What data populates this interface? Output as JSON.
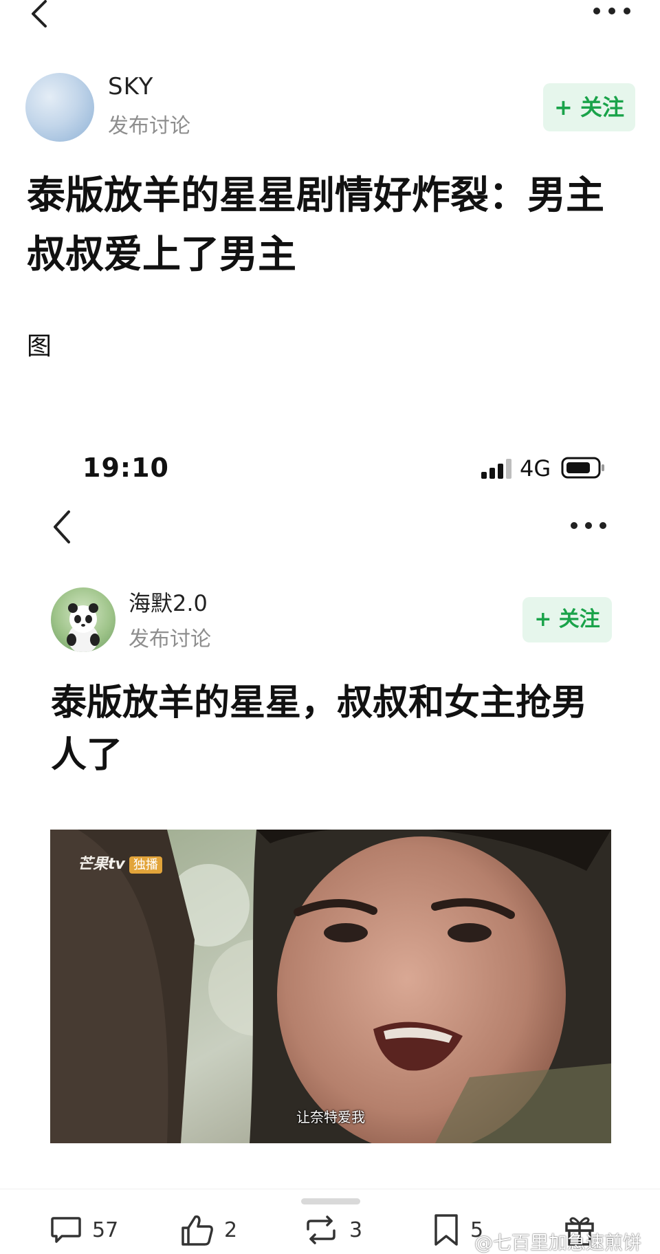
{
  "outer_post": {
    "author": {
      "name": "SKY",
      "subtitle": "发布讨论"
    },
    "follow_label": "+ 关注",
    "title": "泰版放羊的星星剧情好炸裂：男主叔叔爱上了男主",
    "body_text": "图"
  },
  "embedded_screenshot": {
    "status_bar": {
      "time": "19:10",
      "network": "4G"
    },
    "author": {
      "name": "海默2.0",
      "subtitle": "发布讨论"
    },
    "follow_label": "+ 关注",
    "title": "泰版放羊的星星，叔叔和女主抢男人了",
    "video": {
      "logo_text": "芒果tv",
      "logo_badge": "独播",
      "subtitle": "让奈特爱我"
    }
  },
  "actions": {
    "comment_count": "57",
    "like_count": "2",
    "repost_count": "3",
    "favorite_count": "5"
  },
  "watermark": "@七百里加急速煎饼",
  "colors": {
    "follow_text": "#1aa34a",
    "follow_bg": "#e6f6ec",
    "subtitle_gray": "#8e8e8e"
  },
  "icons": [
    "back-icon",
    "more-icon",
    "comment-icon",
    "like-icon",
    "repost-icon",
    "favorite-icon",
    "gift-icon",
    "signal-icon",
    "battery-icon"
  ]
}
